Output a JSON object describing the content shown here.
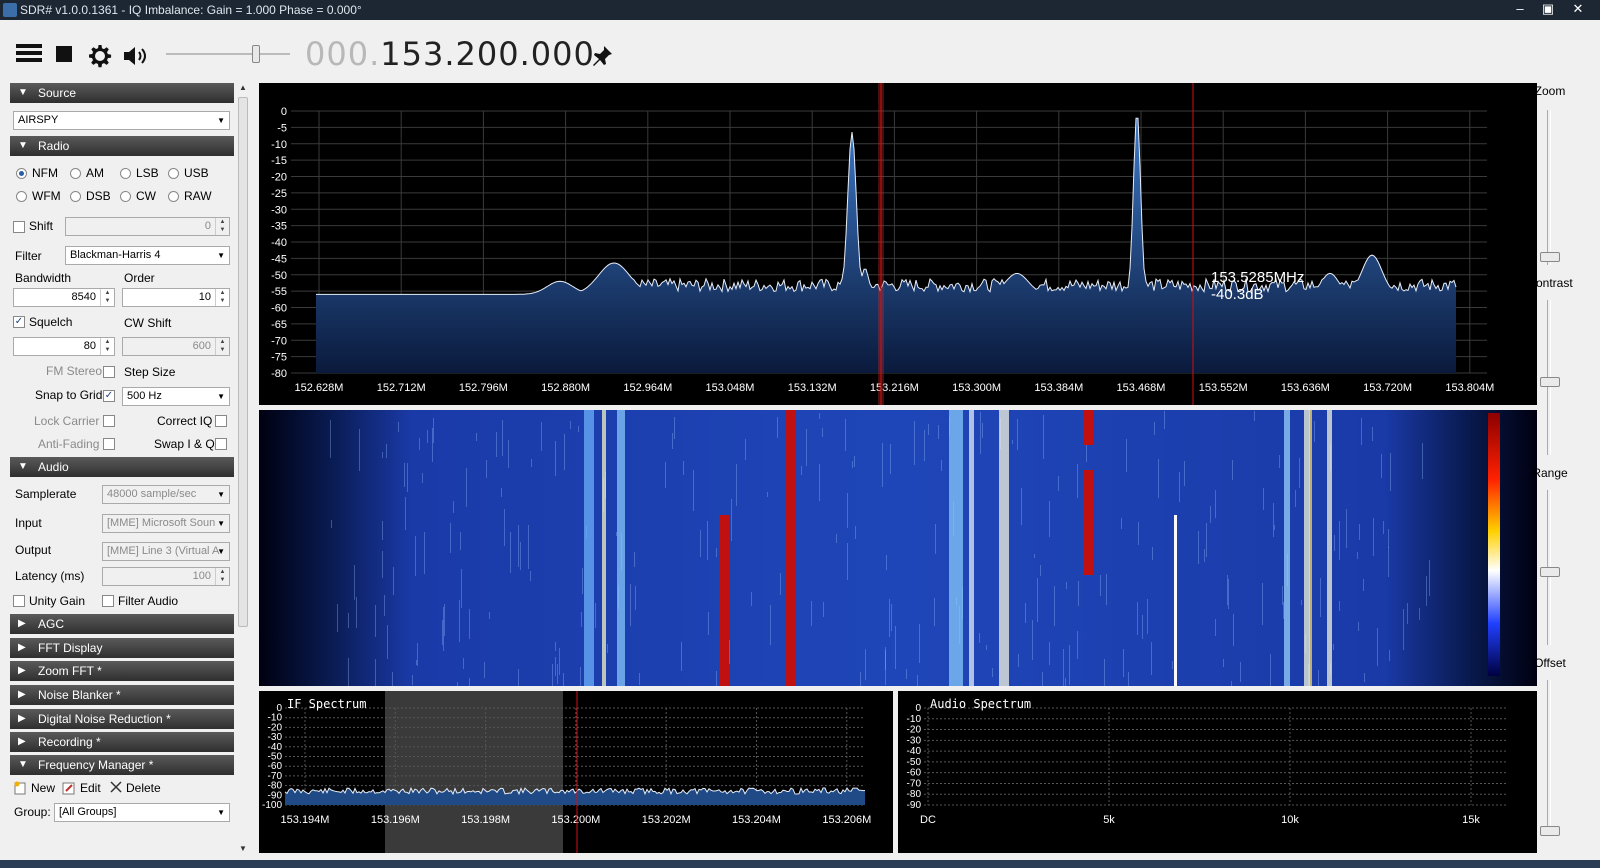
{
  "window": {
    "title": "SDR# v1.0.0.1361 - IQ Imbalance: Gain = 1.000 Phase = 0.000°"
  },
  "toolbar": {
    "icons": [
      "menu-icon",
      "stop-icon",
      "gear-icon",
      "speaker-icon",
      "pin-icon"
    ],
    "frequency_prefix": "000.",
    "frequency_main": "153.200.000"
  },
  "left": {
    "source": {
      "header": "Source",
      "device": "AIRSPY"
    },
    "radio": {
      "header": "Radio",
      "modes": [
        "NFM",
        "AM",
        "LSB",
        "USB",
        "WFM",
        "DSB",
        "CW",
        "RAW"
      ],
      "selected": "NFM",
      "shift_label": "Shift",
      "shift_value": "0",
      "filter_label": "Filter",
      "filter_value": "Blackman-Harris 4",
      "bandwidth_label": "Bandwidth",
      "bandwidth_value": "8540",
      "order_label": "Order",
      "order_value": "10",
      "squelch_label": "Squelch",
      "squelch_value": "80",
      "cwshift_label": "CW Shift",
      "cwshift_value": "600",
      "fmstereo_label": "FM Stereo",
      "stepsize_label": "Step Size",
      "snap_label": "Snap to Grid",
      "snap_value": "500 Hz",
      "lockcarrier_label": "Lock Carrier",
      "correctiq_label": "Correct IQ",
      "antifading_label": "Anti-Fading",
      "swapiq_label": "Swap I & Q"
    },
    "audio": {
      "header": "Audio",
      "samplerate_label": "Samplerate",
      "samplerate_value": "48000 sample/sec",
      "input_label": "Input",
      "input_value": "[MME] Microsoft Soun",
      "output_label": "Output",
      "output_value": "[MME] Line 3 (Virtual A",
      "latency_label": "Latency (ms)",
      "latency_value": "100",
      "unity_label": "Unity Gain",
      "filteraudio_label": "Filter Audio"
    },
    "collapsed": [
      "AGC",
      "FFT Display",
      "Zoom FFT *",
      "Noise Blanker *",
      "Digital Noise Reduction *",
      "Recording *"
    ],
    "freqmgr": {
      "header": "Frequency Manager *",
      "new_label": "New",
      "edit_label": "Edit",
      "delete_label": "Delete",
      "group_label": "Group:",
      "group_value": "[All Groups]"
    }
  },
  "right": {
    "zoom_label": "Zoom",
    "contrast_label": "Contrast",
    "range_label": "Range",
    "offset_label": "Offset"
  },
  "spectrum": {
    "y_ticks": [
      "0",
      "-5",
      "-10",
      "-15",
      "-20",
      "-25",
      "-30",
      "-35",
      "-40",
      "-45",
      "-50",
      "-55",
      "-60",
      "-65",
      "-70",
      "-75",
      "-80"
    ],
    "x_ticks": [
      "152.628M",
      "152.712M",
      "152.796M",
      "152.880M",
      "152.964M",
      "153.048M",
      "153.132M",
      "153.216M",
      "153.300M",
      "153.384M",
      "153.468M",
      "153.552M",
      "153.636M",
      "153.720M",
      "153.804M"
    ],
    "cursor_freq": "153.5285MHz",
    "cursor_level": "-40.3dB"
  },
  "if_spectrum": {
    "title": "IF Spectrum",
    "y_ticks": [
      "0",
      "-10",
      "-20",
      "-30",
      "-40",
      "-50",
      "-60",
      "-70",
      "-80",
      "-90",
      "-100"
    ],
    "x_ticks": [
      "153.194M",
      "153.196M",
      "153.198M",
      "153.200M",
      "153.202M",
      "153.204M",
      "153.206M"
    ]
  },
  "audio_spectrum": {
    "title": "Audio Spectrum",
    "y_ticks": [
      "0",
      "-10",
      "-20",
      "-30",
      "-40",
      "-50",
      "-60",
      "-70",
      "-80",
      "-90"
    ],
    "x_ticks": [
      "DC",
      "5k",
      "10k",
      "15k"
    ]
  },
  "colors": {
    "accent": "#2a5da8",
    "spectrum_fill": "#1f4a86",
    "marker": "#d01010",
    "waterfall_bg": "#0f2f8a"
  }
}
